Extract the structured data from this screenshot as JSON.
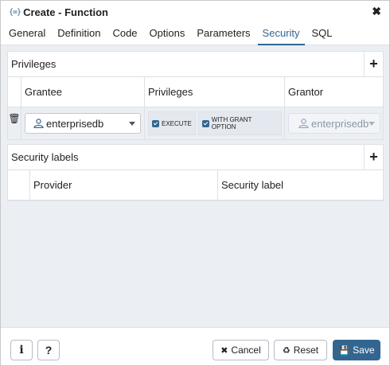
{
  "dialog": {
    "title_icon": "{=}",
    "title": "Create - Function",
    "close_label": "✖"
  },
  "tabs": [
    {
      "label": "General",
      "active": false
    },
    {
      "label": "Definition",
      "active": false
    },
    {
      "label": "Code",
      "active": false
    },
    {
      "label": "Options",
      "active": false
    },
    {
      "label": "Parameters",
      "active": false
    },
    {
      "label": "Security",
      "active": true
    },
    {
      "label": "SQL",
      "active": false
    }
  ],
  "privileges": {
    "title": "Privileges",
    "add_label": "+",
    "columns": {
      "grantee": "Grantee",
      "privileges": "Privileges",
      "grantor": "Grantor"
    },
    "rows": [
      {
        "delete_icon": "🗑",
        "grantee": "enterprisedb",
        "privilege_options": [
          {
            "label": "EXECUTE",
            "checked": true
          },
          {
            "label": "WITH GRANT OPTION",
            "checked": true
          }
        ],
        "grantor": "enterprisedb"
      }
    ]
  },
  "security_labels": {
    "title": "Security labels",
    "add_label": "+",
    "columns": {
      "provider": "Provider",
      "security_label": "Security label"
    }
  },
  "footer": {
    "info_label": "i",
    "help_label": "?",
    "cancel_label": "Cancel",
    "cancel_icon": "✖",
    "reset_label": "Reset",
    "reset_icon": "♻",
    "save_label": "Save",
    "save_icon": "💾"
  },
  "colors": {
    "accent": "#326690",
    "background": "#ebeef3"
  }
}
